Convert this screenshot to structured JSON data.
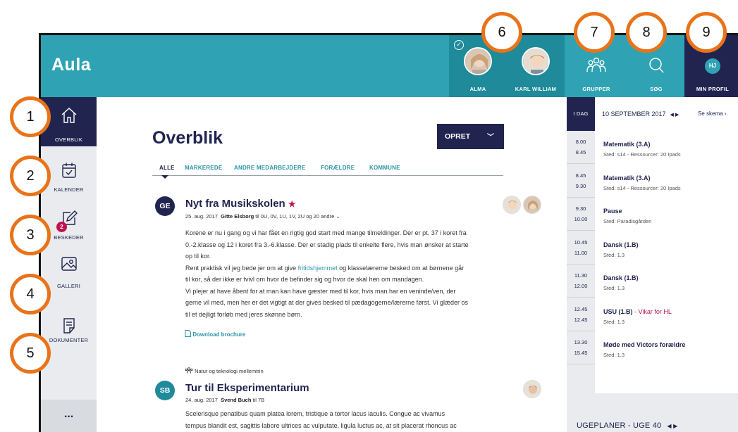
{
  "app": {
    "logo": "Aula"
  },
  "header": {
    "children": [
      {
        "name": "ALMA",
        "selected": true
      },
      {
        "name": "KARL WILLIAM",
        "selected": false
      }
    ],
    "groups_label": "GRUPPER",
    "search_label": "SØG",
    "profile_label": "MIN PROFIL",
    "profile_initials": "HJ"
  },
  "sidebar": {
    "items": [
      {
        "label": "OVERBLIK",
        "icon": "home-icon",
        "active": true
      },
      {
        "label": "KALENDER",
        "icon": "calendar-icon"
      },
      {
        "label": "BESKEDER",
        "icon": "messages-icon",
        "badge": "2"
      },
      {
        "label": "GALLERI",
        "icon": "gallery-icon"
      },
      {
        "label": "DOKUMENTER",
        "icon": "documents-icon"
      }
    ],
    "more_label": "..."
  },
  "main": {
    "title": "Overblik",
    "create_label": "OPRET",
    "tabs": [
      "ALLE",
      "MARKEREDE",
      "ANDRE MEDARBEJDERE",
      "FORÆLDRE",
      "KOMMUNE"
    ],
    "posts": [
      {
        "initials": "GE",
        "title": "Nyt fra Musikskolen",
        "star": "★",
        "date": "25. aug. 2017",
        "author": "Gitte Elsborg",
        "recipients": " til 0U, 0V, 1U, 1V, 2U og 20 andre",
        "body_lines": [
          "Korene er nu i gang og vi har fået en rigtig god start med mange tilmeldinger. Der er pt. 37 i koret fra",
          "0.-2.klasse og 12 i koret fra 3.-6.klasse. Der er stadig plads til enkelte flere, hvis man ønsker at starte",
          "op til kor.",
          "Rent praktisk vil jeg bede jer om at give ",
          "til kor, så der ikke er tvivl om hvor de befinder sig og hvor de skal hen om mandagen.",
          "Vi plejer at have åbent for at man kan have gæster med til kor, hvis man har en veninde/ven, der",
          "gerne vil med, men her er det vigtigt at der gives besked til pædagogerne/lærerne først. Vi glæder os",
          "til et dejligt forløb med jeres skønne børn."
        ],
        "link_text": "fritidshjemmet",
        "line4_rest": " og klasselærerne besked om at børnene går",
        "download_label": "Download brochure"
      },
      {
        "group_tag": "Natur og teknologi mellemtrin",
        "initials": "SB",
        "title": "Tur til Eksperimentarium",
        "date": "24. aug. 2017",
        "author": "Svend Buch",
        "recipients": " til 7B",
        "body_lines": [
          "Scelerisque penatibus quam platea lorem, tristique a tortor lacus iaculis. Congue ac vivamus",
          "tempus blandit est, sagittis labore ultrices ac vulputate, ligula luctus ac, at sit placerat rhoncus ac"
        ]
      }
    ]
  },
  "calendar": {
    "today_label": "I DAG",
    "date_label": "10 SEPTEMBER 2017",
    "schema_label": "Se skema",
    "events": [
      {
        "start": "8.00",
        "end": "8.45",
        "title": "Matematik (3.A)",
        "subtitle": "Sted: s14 - Ressourcer: 20 Ipads"
      },
      {
        "start": "8.45",
        "end": "9.30",
        "title": "Matematik (3.A)",
        "subtitle": "Sted: s14 - Ressourcer: 20 Ipads"
      },
      {
        "start": "9.30",
        "end": "10.00",
        "title": "Pause",
        "subtitle": "Sted: Paradisgården"
      },
      {
        "start": "10.45",
        "end": "11.00",
        "title": "Dansk (1.B)",
        "subtitle": "Sted: 1.3"
      },
      {
        "start": "11.30",
        "end": "12.00",
        "title": "Dansk (1.B)",
        "subtitle": "Sted: 1.3"
      },
      {
        "start": "12.45",
        "end": "12.45",
        "title": "USU (1.B)",
        "title_extra": " - Vikar for HL",
        "subtitle": "Sted: 1.3"
      },
      {
        "start": "13.30",
        "end": "15.45",
        "title": "Møde med Victors forældre",
        "subtitle": "Sted: 1.3"
      }
    ],
    "ugeplaner_label": "UGEPLANER - UGE 40"
  },
  "callouts": [
    "1",
    "2",
    "3",
    "4",
    "5",
    "6",
    "7",
    "8",
    "9"
  ],
  "colors": {
    "brand_teal": "#2fa3b3",
    "navy": "#222450",
    "accent_red": "#c0124f",
    "callout_orange": "#e8731a"
  }
}
